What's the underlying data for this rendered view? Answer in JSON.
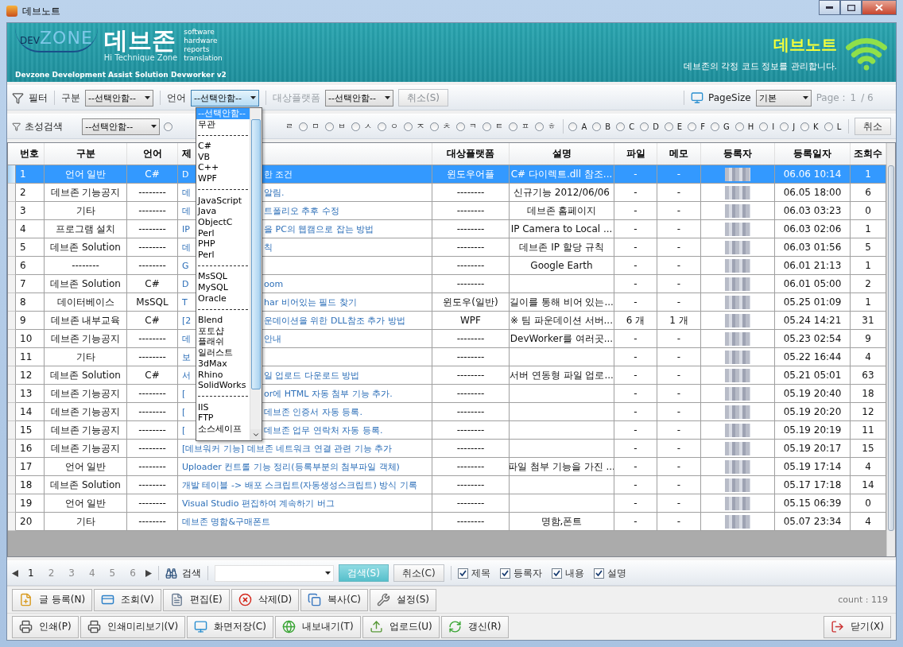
{
  "window": {
    "title": "데브노트"
  },
  "banner": {
    "logo_prefix": "DEV",
    "logo_word": "ZONE",
    "brand": "데브존",
    "tagline": [
      "software",
      "hardware",
      "reports",
      "translation"
    ],
    "motto": "Hi Technique Zone",
    "product": "Devzone Development Assist Solution Devworker v2",
    "app_name": "데브노트",
    "description": "데브존의 각정 코드 정보를 관리합니다."
  },
  "filter_bar": {
    "label": "필터",
    "fields": [
      {
        "label": "구분",
        "value": "--선택안함--",
        "disabled": false,
        "open": false
      },
      {
        "label": "언어",
        "value": "--선택안함--",
        "disabled": false,
        "open": true
      },
      {
        "label": "대상플랫폼",
        "value": "--선택안함--",
        "disabled": true,
        "open": false
      }
    ],
    "cancel": {
      "label": "취소(S)",
      "disabled": true
    },
    "page_size_label": "PageSize",
    "page_size": "기본",
    "page_label": "Page :",
    "page_current": "1",
    "page_total": "/ 6"
  },
  "language_dropdown": {
    "items": [
      {
        "kind": "option",
        "label": "--선택안함--",
        "selected": true
      },
      {
        "kind": "option",
        "label": "무관",
        "selected": false
      },
      {
        "kind": "separator"
      },
      {
        "kind": "option",
        "label": "C#",
        "selected": false
      },
      {
        "kind": "option",
        "label": "VB",
        "selected": false
      },
      {
        "kind": "option",
        "label": "C++",
        "selected": false
      },
      {
        "kind": "option",
        "label": "WPF",
        "selected": false
      },
      {
        "kind": "separator"
      },
      {
        "kind": "option",
        "label": "JavaScript",
        "selected": false
      },
      {
        "kind": "option",
        "label": "Java",
        "selected": false
      },
      {
        "kind": "option",
        "label": "ObjectC",
        "selected": false
      },
      {
        "kind": "option",
        "label": "Perl",
        "selected": false
      },
      {
        "kind": "option",
        "label": "PHP",
        "selected": false
      },
      {
        "kind": "option",
        "label": "Perl",
        "selected": false
      },
      {
        "kind": "separator"
      },
      {
        "kind": "option",
        "label": "MsSQL",
        "selected": false
      },
      {
        "kind": "option",
        "label": "MySQL",
        "selected": false
      },
      {
        "kind": "option",
        "label": "Oracle",
        "selected": false
      },
      {
        "kind": "separator"
      },
      {
        "kind": "option",
        "label": "Blend",
        "selected": false
      },
      {
        "kind": "option",
        "label": "포토샵",
        "selected": false
      },
      {
        "kind": "option",
        "label": "플래쉬",
        "selected": false
      },
      {
        "kind": "option",
        "label": "일러스트",
        "selected": false
      },
      {
        "kind": "option",
        "label": "3dMax",
        "selected": false
      },
      {
        "kind": "option",
        "label": "Rhino",
        "selected": false
      },
      {
        "kind": "option",
        "label": "SolidWorks",
        "selected": false
      },
      {
        "kind": "separator"
      },
      {
        "kind": "option",
        "label": "IIS",
        "selected": false
      },
      {
        "kind": "option",
        "label": "FTP",
        "selected": false
      },
      {
        "kind": "option",
        "label": "소스세이프",
        "selected": false
      }
    ]
  },
  "initial_search": {
    "label": "초성검색",
    "value": "--선택안함--",
    "cancel": "취소",
    "options": [
      {
        "kind": "radio",
        "selected": false
      },
      {
        "kind": "label",
        "label": "ㄹ"
      },
      {
        "kind": "option",
        "label": "ㅁ",
        "selected": false
      },
      {
        "kind": "option",
        "label": "ㅂ",
        "selected": false
      },
      {
        "kind": "option",
        "label": "ㅅ",
        "selected": false
      },
      {
        "kind": "option",
        "label": "ㅇ",
        "selected": false
      },
      {
        "kind": "option",
        "label": "ㅈ",
        "selected": false
      },
      {
        "kind": "option",
        "label": "ㅊ",
        "selected": false
      },
      {
        "kind": "option",
        "label": "ㅋ",
        "selected": false
      },
      {
        "kind": "option",
        "label": "ㅌ",
        "selected": false
      },
      {
        "kind": "option",
        "label": "ㅍ",
        "selected": false
      },
      {
        "kind": "option",
        "label": "ㅎ",
        "selected": false
      },
      {
        "kind": "divider"
      },
      {
        "kind": "option",
        "label": "A",
        "selected": false
      },
      {
        "kind": "option",
        "label": "B",
        "selected": false
      },
      {
        "kind": "option",
        "label": "C",
        "selected": false
      },
      {
        "kind": "option",
        "label": "D",
        "selected": false
      },
      {
        "kind": "option",
        "label": "E",
        "selected": false
      },
      {
        "kind": "option",
        "label": "F",
        "selected": false
      },
      {
        "kind": "option",
        "label": "G",
        "selected": false
      },
      {
        "kind": "option",
        "label": "H",
        "selected": false
      },
      {
        "kind": "option",
        "label": "I",
        "selected": false
      },
      {
        "kind": "option",
        "label": "J",
        "selected": false
      },
      {
        "kind": "option",
        "label": "K",
        "selected": false
      },
      {
        "kind": "option",
        "label": "L",
        "selected": false
      }
    ]
  },
  "table": {
    "columns": [
      "번호",
      "구분",
      "언어",
      "제",
      "대상플랫폼",
      "설명",
      "파일",
      "메모",
      "등록자",
      "등록일자",
      "조회수"
    ],
    "rows": [
      {
        "no": "1",
        "category": "언어 일반",
        "lang": "C#",
        "title_head": "D",
        "title_tail": "한 조건",
        "platform": "윈도우어플",
        "desc": "C# 다이렉트.dll 참조...",
        "file": "-",
        "memo": "-",
        "date": "06.06 10:14",
        "views": "1",
        "selected": true
      },
      {
        "no": "2",
        "category": "데브존 기능공지",
        "lang": "--------",
        "title_head": "데",
        "title_tail": "알림.",
        "platform": "--------",
        "desc": "신규기능 2012/06/06",
        "file": "-",
        "memo": "-",
        "date": "06.05 18:00",
        "views": "6",
        "selected": false
      },
      {
        "no": "3",
        "category": "기타",
        "lang": "--------",
        "title_head": "데",
        "title_tail": "트폴리오 추후 수정",
        "platform": "--------",
        "desc": "데브존 홈페이지",
        "file": "-",
        "memo": "-",
        "date": "06.03 03:23",
        "views": "0",
        "selected": false
      },
      {
        "no": "4",
        "category": "프로그램 설치",
        "lang": "--------",
        "title_head": "IP",
        "title_tail": "을 PC의 웹캠으로 잡는 방법",
        "platform": "--------",
        "desc": "IP Camera to Local ...",
        "file": "-",
        "memo": "-",
        "date": "06.03 02:06",
        "views": "1",
        "selected": false
      },
      {
        "no": "5",
        "category": "데브존 Solution",
        "lang": "--------",
        "title_head": "데",
        "title_tail": "칙",
        "platform": "--------",
        "desc": "데브존 IP 할당 규칙",
        "file": "-",
        "memo": "-",
        "date": "06.03 01:56",
        "views": "5",
        "selected": false
      },
      {
        "no": "6",
        "category": "--------",
        "lang": "--------",
        "title_head": "G",
        "platform": "--------",
        "desc": "Google Earth",
        "file": "-",
        "memo": "-",
        "date": "06.01 21:13",
        "views": "1",
        "selected": false
      },
      {
        "no": "7",
        "category": "데브존 Solution",
        "lang": "C#",
        "title_head": "D",
        "title_tail": "oom",
        "platform": "--------",
        "file": "-",
        "memo": "-",
        "date": "06.01 05:00",
        "views": "2",
        "selected": false
      },
      {
        "no": "8",
        "category": "데이터베이스",
        "lang": "MsSQL",
        "title_head": "T",
        "title_tail": "har 비어있는 필드 찾기",
        "platform": "윈도우(일반)",
        "desc": "길이를 통해 비어 있는...",
        "file": "-",
        "memo": "-",
        "date": "05.25 01:09",
        "views": "1",
        "selected": false
      },
      {
        "no": "9",
        "category": "데브존 내부교육",
        "lang": "C#",
        "title_head": "[2",
        "title_tail": "운데이션을 위한 DLL참조 추가 방법",
        "platform": "WPF",
        "desc": "※ 팀 파운데이션 서버...",
        "file": "6 개",
        "memo": "1 개",
        "date": "05.24 14:21",
        "views": "31",
        "selected": false
      },
      {
        "no": "10",
        "category": "데브존 기능공지",
        "lang": "--------",
        "title_head": "데",
        "title_tail": "안내",
        "platform": "--------",
        "desc": "DevWorker를 여러곳...",
        "file": "-",
        "memo": "-",
        "date": "05.23 02:54",
        "views": "9",
        "selected": false
      },
      {
        "no": "11",
        "category": "기타",
        "lang": "--------",
        "title_head": "보",
        "platform": "--------",
        "file": "-",
        "memo": "-",
        "date": "05.22 16:44",
        "views": "4",
        "selected": false
      },
      {
        "no": "12",
        "category": "데브존 Solution",
        "lang": "C#",
        "title_head": "서",
        "title_tail": "일 업로드 다운로드 방법",
        "platform": "--------",
        "desc": "서버 연동형 파일 업로...",
        "file": "-",
        "memo": "-",
        "date": "05.21 05:01",
        "views": "63",
        "selected": false
      },
      {
        "no": "13",
        "category": "데브존 기능공지",
        "lang": "--------",
        "title_head": "[",
        "title_tail": "or에 HTML 자동 첨부 기능 추가.",
        "platform": "--------",
        "file": "-",
        "memo": "-",
        "date": "05.19 20:40",
        "views": "18",
        "selected": false
      },
      {
        "no": "14",
        "category": "데브존 기능공지",
        "lang": "--------",
        "title_head": "[",
        "title_tail": "데브존 인증서 자동 등록.",
        "platform": "--------",
        "file": "-",
        "memo": "-",
        "date": "05.19 20:20",
        "views": "12",
        "selected": false
      },
      {
        "no": "15",
        "category": "데브존 기능공지",
        "lang": "--------",
        "title_head": "[",
        "title_tail": "데브존 업무 연락처 자동 등록.",
        "platform": "--------",
        "file": "-",
        "memo": "-",
        "date": "05.19 20:19",
        "views": "11",
        "selected": false
      },
      {
        "no": "16",
        "category": "데브존 기능공지",
        "lang": "--------",
        "title": "[데브워커 기능] 데브존 네트워크 연결 관련 기능 추가",
        "platform": "--------",
        "file": "-",
        "memo": "-",
        "date": "05.19 20:17",
        "views": "15",
        "selected": false
      },
      {
        "no": "17",
        "category": "언어 일반",
        "lang": "--------",
        "title": "Uploader 컨트롤 기능 정리(등록부분의 첨부파일 객체)",
        "platform": "--------",
        "desc": "파일 첨부 기능을 가진 ...",
        "file": "-",
        "memo": "-",
        "date": "05.19 17:14",
        "views": "4",
        "selected": false
      },
      {
        "no": "18",
        "category": "데브존 Solution",
        "lang": "--------",
        "title": "개발 테이블 -> 배포 스크립트(자동생성스크립트) 방식 기록",
        "platform": "--------",
        "file": "-",
        "memo": "-",
        "date": "05.17 17:18",
        "views": "14",
        "selected": false
      },
      {
        "no": "19",
        "category": "언어 일반",
        "lang": "--------",
        "title": "Visual Studio 편집하여 계속하기 버그",
        "platform": "--------",
        "file": "-",
        "memo": "-",
        "date": "05.15 06:39",
        "views": "0",
        "selected": false
      },
      {
        "no": "20",
        "category": "기타",
        "lang": "--------",
        "title": "데브존 명함&구매폰트",
        "platform": "--------",
        "desc": "명함,폰트",
        "file": "-",
        "memo": "-",
        "date": "05.07 23:34",
        "views": "4",
        "selected": false
      }
    ]
  },
  "pagination": {
    "pages": [
      {
        "label": "1",
        "selected": true
      },
      {
        "label": "2",
        "selected": false
      },
      {
        "label": "3",
        "selected": false
      },
      {
        "label": "4",
        "selected": false
      },
      {
        "label": "5",
        "selected": false
      },
      {
        "label": "6",
        "selected": false
      }
    ]
  },
  "search": {
    "label": "검색",
    "button": "검색(S)",
    "cancel": "취소(C)",
    "scopes": [
      {
        "label": "제목",
        "checked": true
      },
      {
        "label": "등록자",
        "checked": true
      },
      {
        "label": "내용",
        "checked": true
      },
      {
        "label": "설명",
        "checked": true
      }
    ]
  },
  "actions": [
    "글 등록(N)",
    "조회(V)",
    "편집(E)",
    "삭제(D)",
    "복사(C)",
    "설정(S)"
  ],
  "count": "count : 119",
  "actions_2": [
    "인쇄(P)",
    "인쇄미리보기(V)",
    "화면저장(C)",
    "내보내기(T)",
    "업로드(U)",
    "갱신(R)"
  ],
  "close_button": "닫기(X)"
}
